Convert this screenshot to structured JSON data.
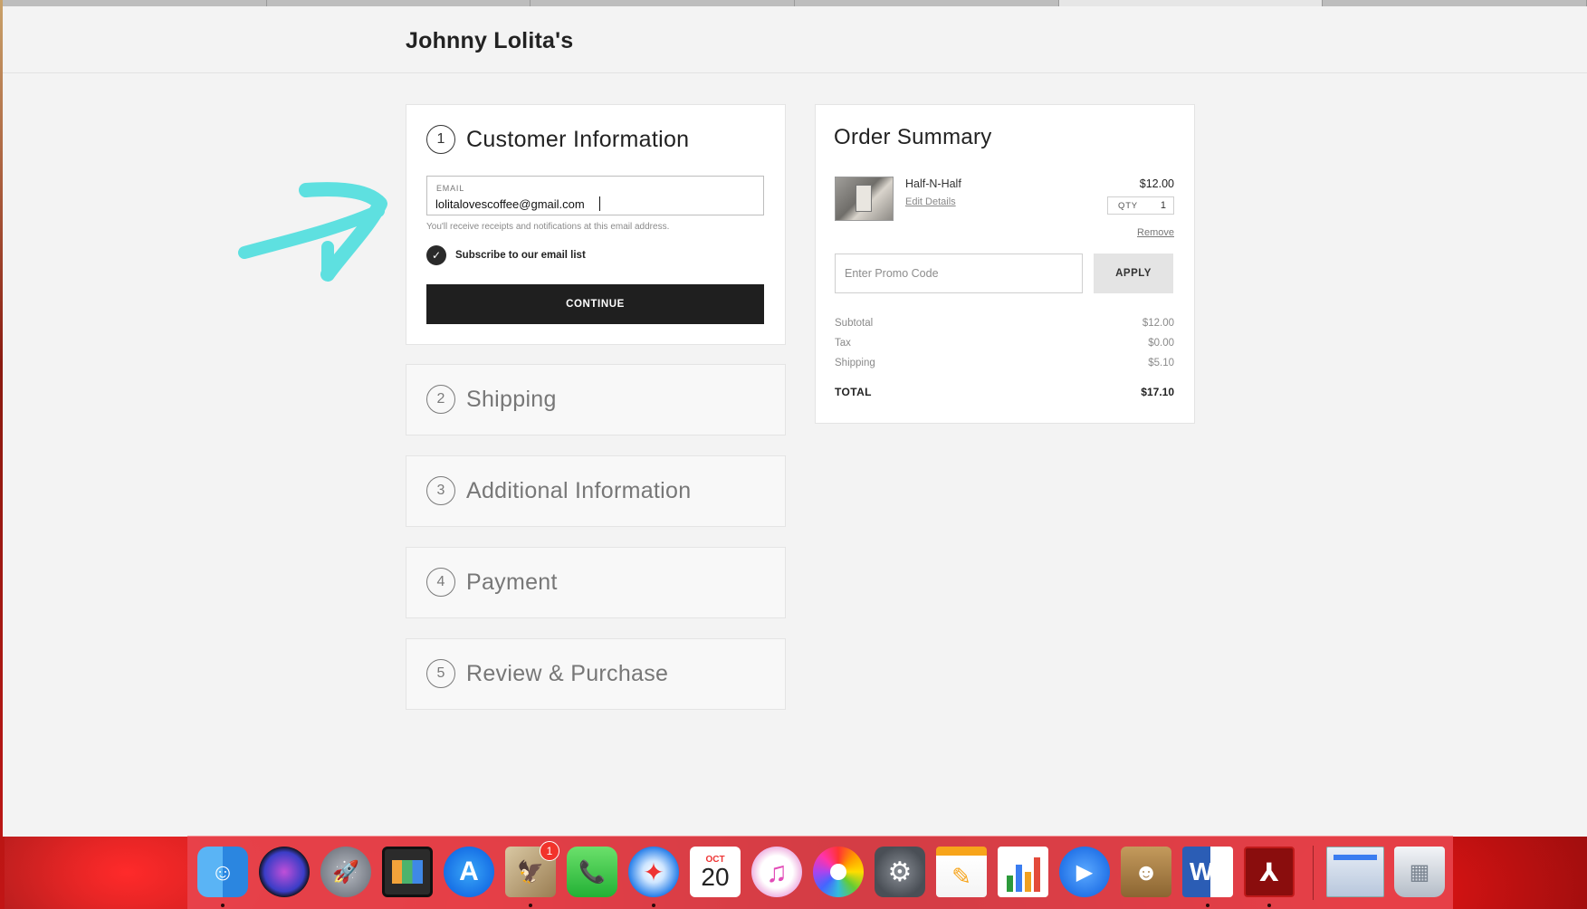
{
  "site": {
    "title": "Johnny Lolita's"
  },
  "checkout": {
    "customer": {
      "step_number": "1",
      "title": "Customer Information",
      "email_label": "EMAIL",
      "email_value": "lolitalovescoffee@gmail.com",
      "email_hint": "You'll receive receipts and notifications at this email address.",
      "subscribe_label": "Subscribe to our email list",
      "subscribe_checked": true,
      "continue_label": "CONTINUE"
    },
    "steps": [
      {
        "number": "2",
        "title": "Shipping"
      },
      {
        "number": "3",
        "title": "Additional Information"
      },
      {
        "number": "4",
        "title": "Payment"
      },
      {
        "number": "5",
        "title": "Review & Purchase"
      }
    ]
  },
  "order_summary": {
    "title": "Order Summary",
    "item": {
      "name": "Half-N-Half",
      "edit_label": "Edit Details",
      "price": "$12.00",
      "qty_label": "QTY",
      "qty_value": "1",
      "remove_label": "Remove"
    },
    "promo_placeholder": "Enter Promo Code",
    "apply_label": "APPLY",
    "totals": [
      {
        "label": "Subtotal",
        "value": "$12.00"
      },
      {
        "label": "Tax",
        "value": "$0.00"
      },
      {
        "label": "Shipping",
        "value": "$5.10"
      }
    ],
    "grand_total": {
      "label": "TOTAL",
      "value": "$17.10"
    }
  },
  "colors": {
    "annotation_arrow": "#5ee0e0",
    "button_dark": "#1f1f1f",
    "dock": "#e8464e"
  },
  "dock": {
    "items": [
      {
        "name": "finder-icon",
        "running": true
      },
      {
        "name": "siri-icon",
        "running": false
      },
      {
        "name": "launchpad-icon",
        "running": false
      },
      {
        "name": "photo-booth-icon",
        "running": false
      },
      {
        "name": "app-store-icon",
        "running": false
      },
      {
        "name": "mail-icon",
        "running": true,
        "badge": "1"
      },
      {
        "name": "facetime-icon",
        "running": false
      },
      {
        "name": "safari-icon",
        "running": true
      },
      {
        "name": "calendar-icon",
        "running": false,
        "month": "OCT",
        "day": "20"
      },
      {
        "name": "itunes-icon",
        "running": false
      },
      {
        "name": "photos-icon",
        "running": false
      },
      {
        "name": "system-preferences-icon",
        "running": false
      },
      {
        "name": "pages-icon",
        "running": false
      },
      {
        "name": "numbers-icon",
        "running": false
      },
      {
        "name": "zoom-icon",
        "running": false
      },
      {
        "name": "contacts-icon",
        "running": false
      },
      {
        "name": "word-icon",
        "running": true
      },
      {
        "name": "acrobat-icon",
        "running": true
      },
      {
        "name": "preview-window-icon",
        "running": false
      },
      {
        "name": "trash-icon",
        "running": false
      }
    ]
  }
}
